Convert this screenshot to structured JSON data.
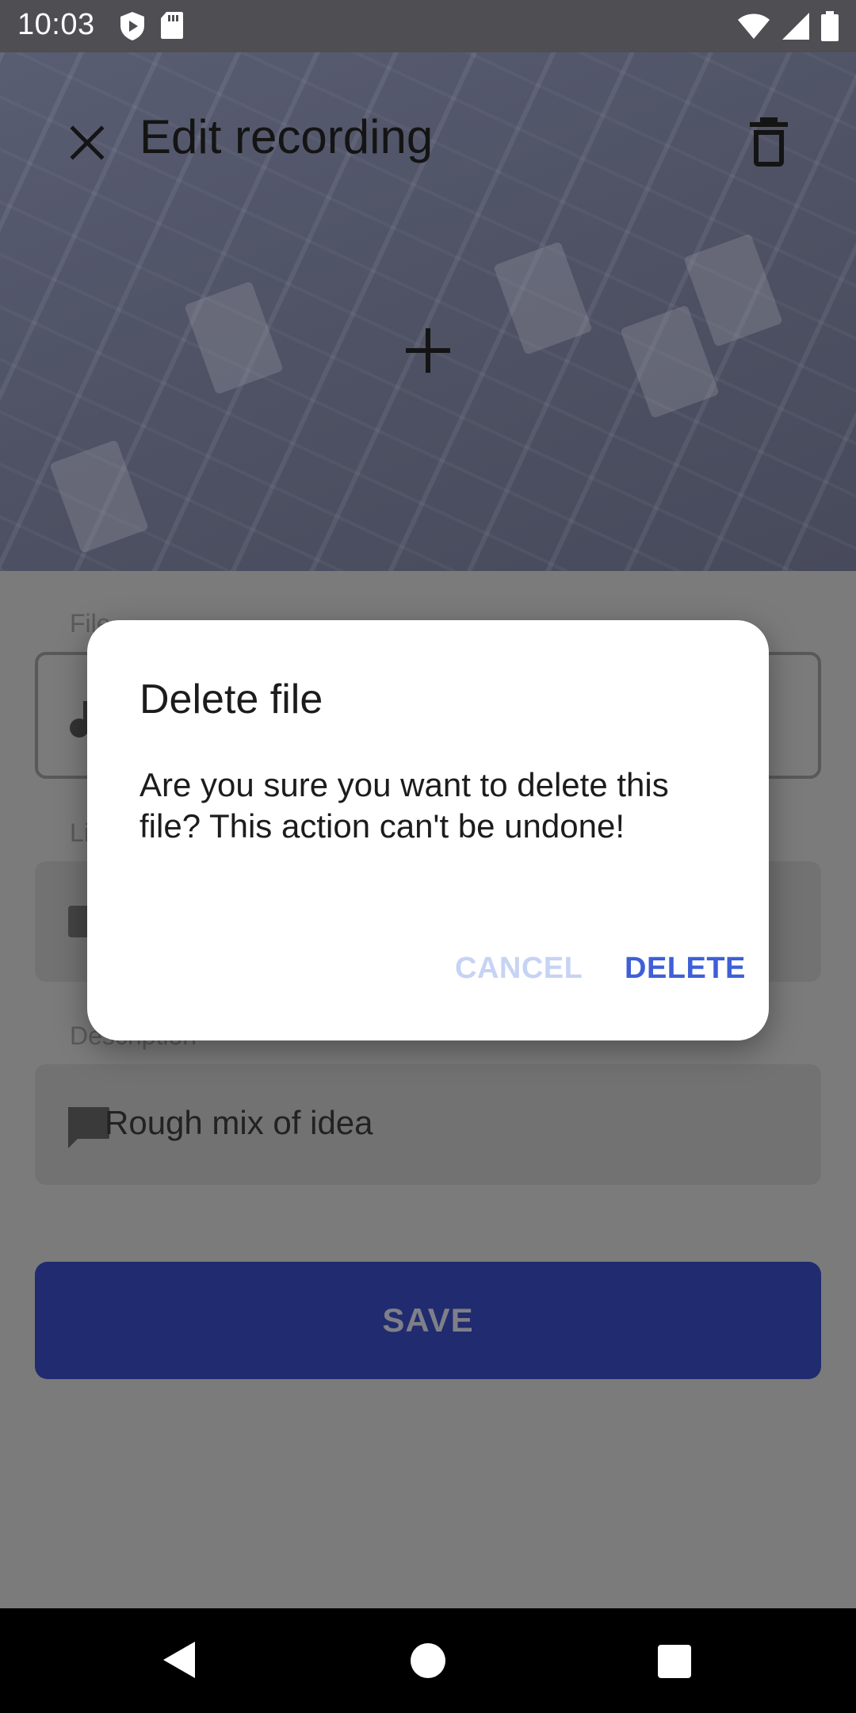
{
  "status_bar": {
    "time": "10:03",
    "left_icons": [
      "shield-play-icon",
      "sd-card-icon"
    ],
    "right_icons": [
      "wifi-icon",
      "signal-icon",
      "battery-icon"
    ]
  },
  "toolbar": {
    "title": "Edit recording",
    "close_icon": "close-icon",
    "delete_icon": "trash-icon"
  },
  "header_image": {
    "add_icon": "plus-icon"
  },
  "form": {
    "file_label": "File",
    "link_label": "Link",
    "description_label": "Description",
    "description_value": "Rough mix of idea",
    "save_label": "SAVE"
  },
  "dialog": {
    "title": "Delete file",
    "message": "Are you sure you want to delete this file? This action can't be undone!",
    "cancel_label": "CANCEL",
    "delete_label": "DELETE"
  },
  "colors": {
    "accent": "#3e5fd8",
    "save_button": "#202b70",
    "cancel_disabled": "#c7d3f3"
  }
}
